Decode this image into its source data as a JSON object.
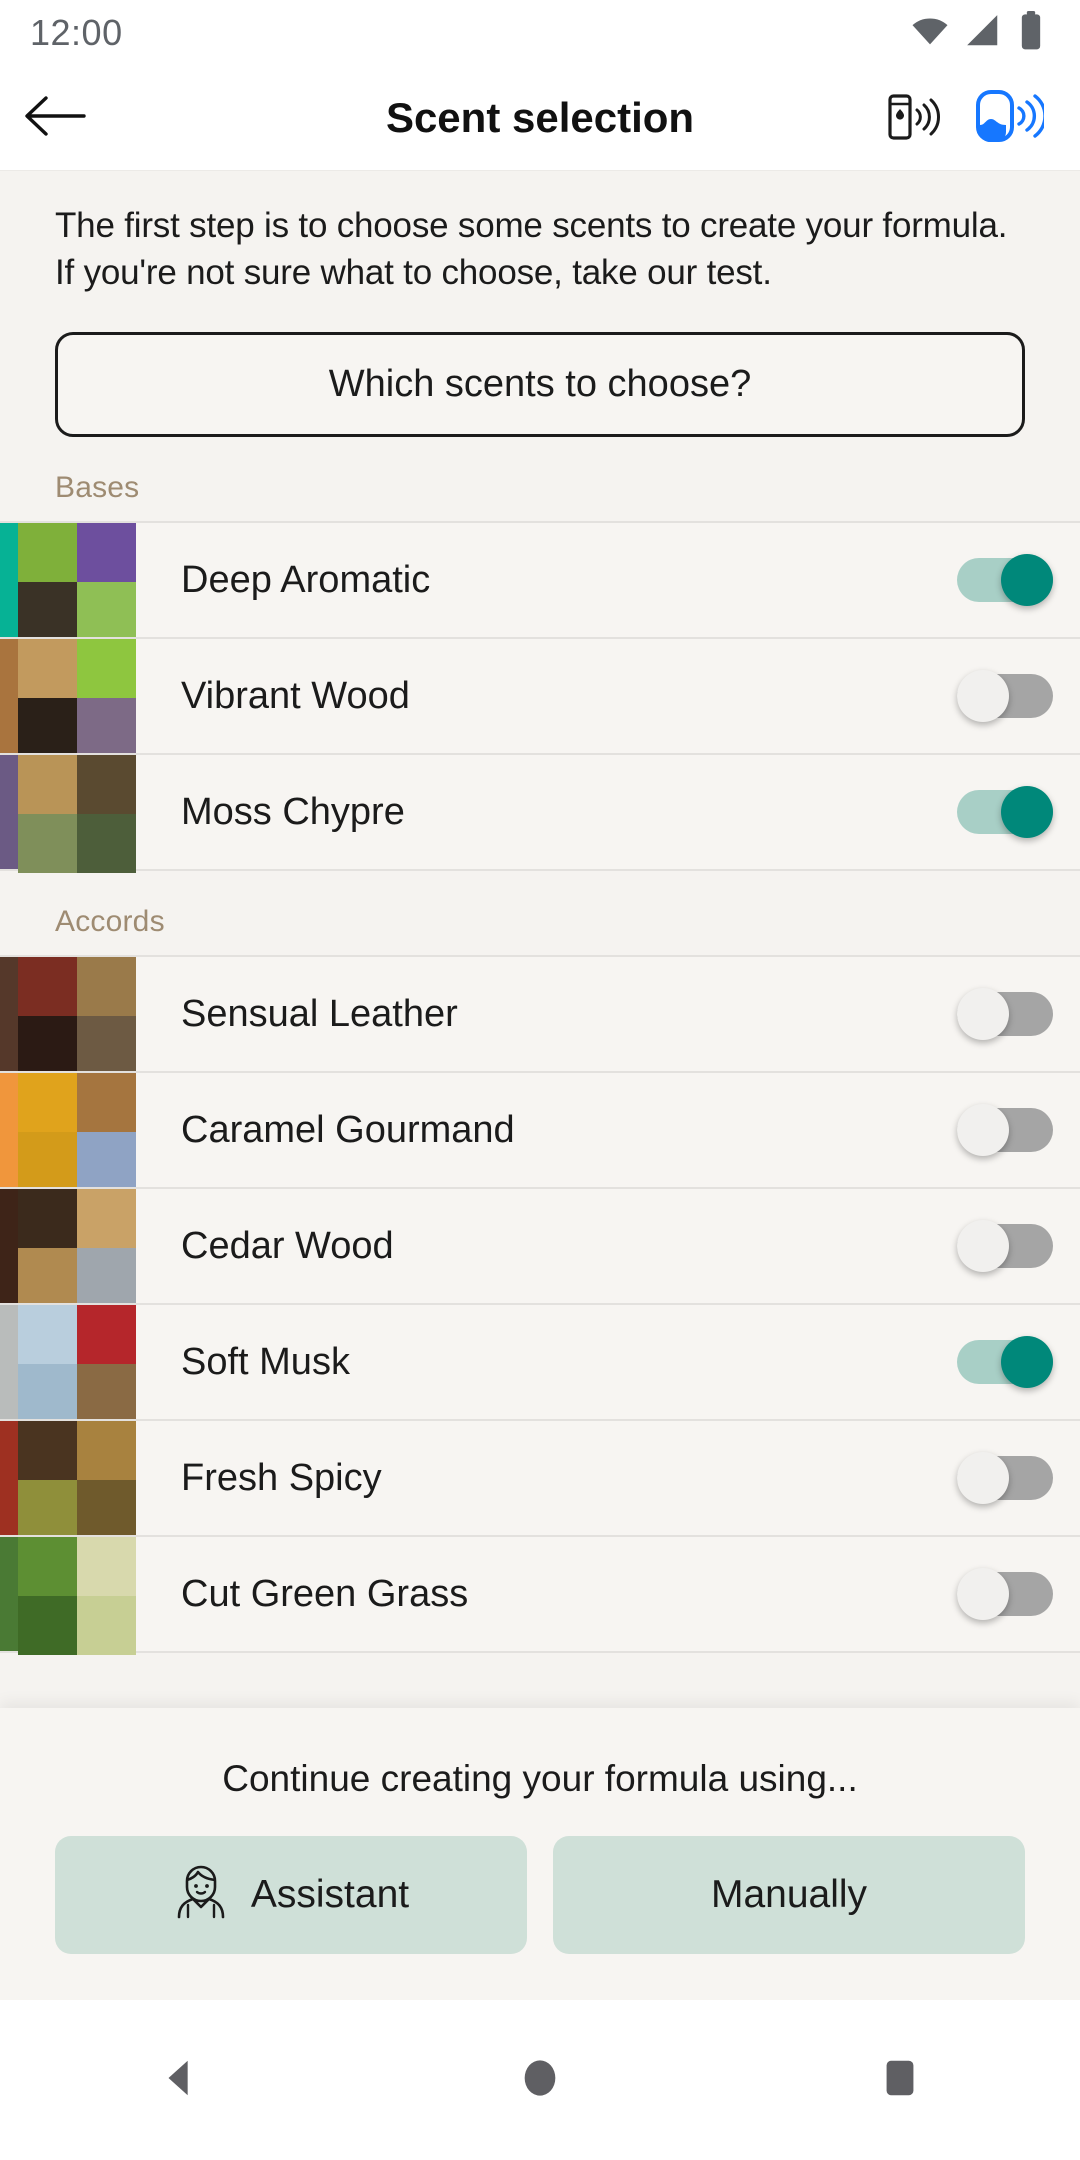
{
  "status_bar": {
    "clock": "12:00",
    "icons": [
      "wifi-icon",
      "cellular-signal-icon",
      "battery-icon"
    ]
  },
  "app_bar": {
    "back_icon": "arrow-left-icon",
    "title": "Scent selection",
    "actions": [
      {
        "icon": "cartridge-wireless-icon",
        "color": "#1b1b1b"
      },
      {
        "icon": "diffuser-wireless-icon",
        "color": "#1677ff"
      }
    ]
  },
  "main": {
    "intro": "The first step is to choose some scents to create your formula. If you're not sure what to choose, take our test.",
    "choose_button": "Which scents to choose?",
    "sections": [
      {
        "label": "Bases",
        "items": [
          {
            "name": "Deep Aromatic",
            "accent": "#06b295",
            "on": true,
            "tiles": [
              "#7fb03a",
              "#6d4f9e",
              "#3a3226",
              "#8fbf55"
            ]
          },
          {
            "name": "Vibrant Wood",
            "accent": "#a9743e",
            "on": false,
            "tiles": [
              "#c29a5e",
              "#8ec63f",
              "#2a2018",
              "#7d6a86"
            ]
          },
          {
            "name": "Moss Chypre",
            "accent": "#6b5a84",
            "on": true,
            "tiles": [
              "#b99457",
              "#5a4a30",
              "#7f8f5a",
              "#4d5e3a"
            ]
          }
        ]
      },
      {
        "label": "Accords",
        "items": [
          {
            "name": "Sensual Leather",
            "accent": "#55382a",
            "on": false,
            "tiles": [
              "#7b2d22",
              "#9a7a4a",
              "#2b1a14",
              "#6d5a43"
            ]
          },
          {
            "name": "Caramel Gourmand",
            "accent": "#f0963c",
            "on": false,
            "tiles": [
              "#e0a31c",
              "#a5753f",
              "#d39b1a",
              "#8fa3c4"
            ]
          },
          {
            "name": "Cedar Wood",
            "accent": "#3e2418",
            "on": false,
            "tiles": [
              "#3b2a1c",
              "#c9a267",
              "#b08a50",
              "#9fa6ad"
            ]
          },
          {
            "name": "Soft Musk",
            "accent": "#b9bcbb",
            "on": true,
            "tiles": [
              "#b9cedd",
              "#b5262b",
              "#9fb9cc",
              "#8a6a44"
            ]
          },
          {
            "name": "Fresh Spicy",
            "accent": "#9e3021",
            "on": false,
            "tiles": [
              "#4a3420",
              "#a8823f",
              "#8f8f3a",
              "#6f5a2c"
            ]
          },
          {
            "name": "Cut Green Grass",
            "accent": "#4a7a34",
            "on": false,
            "tiles": [
              "#5d8f33",
              "#d8d9ad",
              "#3f6b26",
              "#c7cf94"
            ]
          }
        ]
      }
    ]
  },
  "bottom_panel": {
    "title": "Continue creating your formula using...",
    "buttons": [
      {
        "label": "Assistant",
        "icon": "assistant-avatar-icon"
      },
      {
        "label": "Manually",
        "icon": null
      }
    ]
  },
  "nav_bar": {
    "items": [
      "back-nav-icon",
      "home-nav-icon",
      "recents-nav-icon"
    ]
  },
  "colors": {
    "page_bg": "#f5f3f0",
    "surface": "#f7f5f2",
    "header_bg": "#ffffff",
    "section_label": "#9e8b72",
    "toggle_on_thumb": "#00887a",
    "toggle_on_track": "#a8cfc6",
    "toggle_off_track": "#a5a5a5",
    "button_mint": "#cfe0d8",
    "accent_blue": "#1677ff"
  }
}
